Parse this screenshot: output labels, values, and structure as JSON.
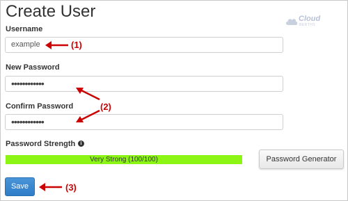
{
  "page": {
    "title": "Create User"
  },
  "brand": {
    "name": "Cloud",
    "sub": "BERTHS"
  },
  "form": {
    "username": {
      "label": "Username",
      "value": "example"
    },
    "new_password": {
      "label": "New Password",
      "value": "••••••••••••"
    },
    "confirm_password": {
      "label": "Confirm Password",
      "value": "••••••••••••"
    },
    "strength": {
      "label": "Password Strength",
      "text": "Very Strong (100/100)",
      "score": 100
    },
    "generator_label": "Password Generator",
    "save_label": "Save"
  },
  "annotations": {
    "a1": "(1)",
    "a2": "(2)",
    "a3": "(3)"
  },
  "colors": {
    "annotation": "#cc0000",
    "strength_fill": "#8cf514",
    "save": "#2e7dc6"
  },
  "icons": {
    "info": "info-icon",
    "brand": "cloud-icon"
  }
}
